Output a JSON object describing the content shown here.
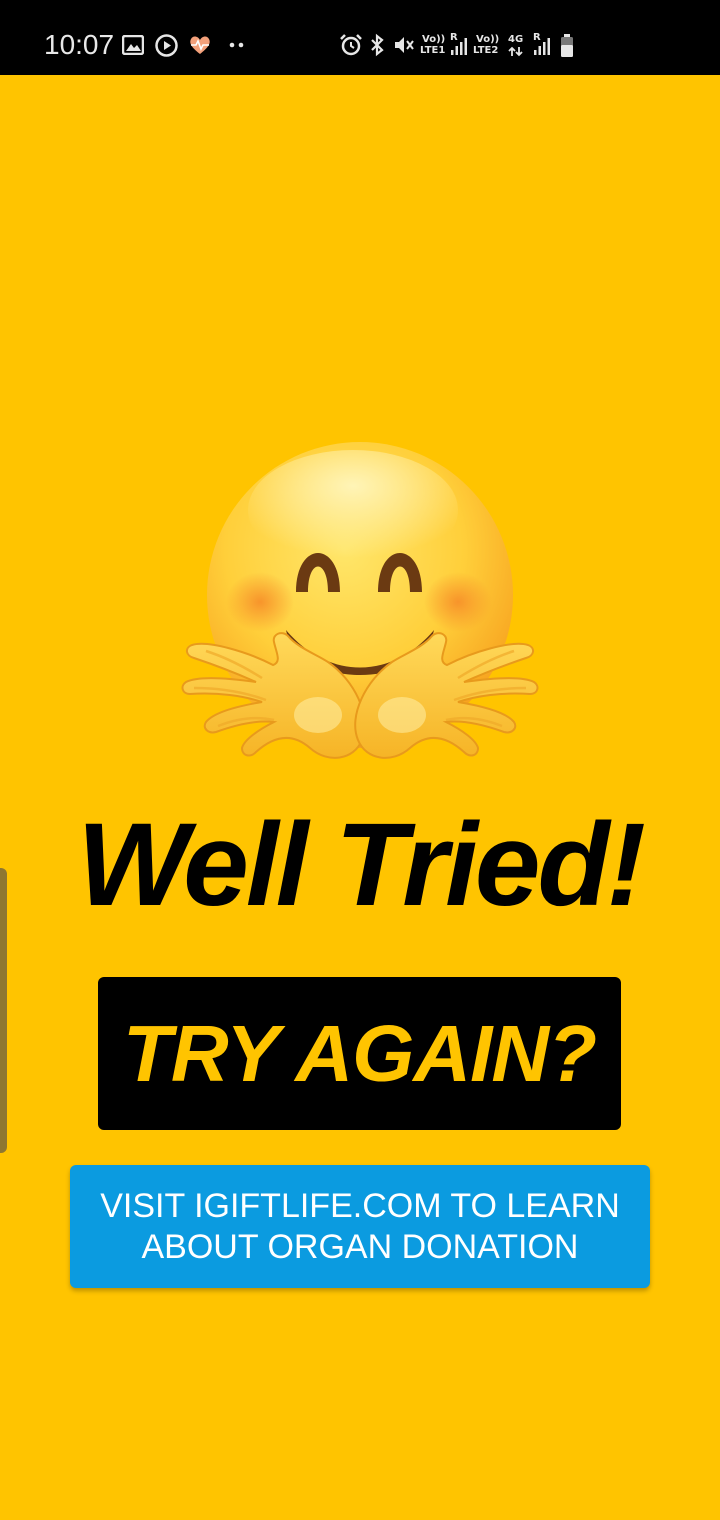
{
  "status_bar": {
    "time": "10:07",
    "sim1_label_top": "Vo))",
    "sim1_label_bottom": "LTE1",
    "sim1_roaming": "R",
    "sim2_label_top": "Vo))",
    "sim2_label_bottom": "LTE2",
    "network_type": "4G",
    "sim2_roaming": "R",
    "icons": [
      "gallery-icon",
      "play-icon",
      "heart-rate-icon",
      "more-dots-icon",
      "alarm-icon",
      "bluetooth-icon",
      "mute-icon",
      "signal-icon",
      "battery-icon"
    ]
  },
  "game_over": {
    "emoji": "hugging-face-icon",
    "title": "Well Tried!",
    "try_again_label": "TRY AGAIN?",
    "visit_label": "VISIT IGIFTLIFE.COM TO LEARN ABOUT ORGAN DONATION"
  },
  "colors": {
    "background": "#ffc400",
    "try_again_bg": "#000000",
    "try_again_text": "#ffc400",
    "visit_bg": "#0b9be0",
    "visit_text": "#ffffff"
  }
}
